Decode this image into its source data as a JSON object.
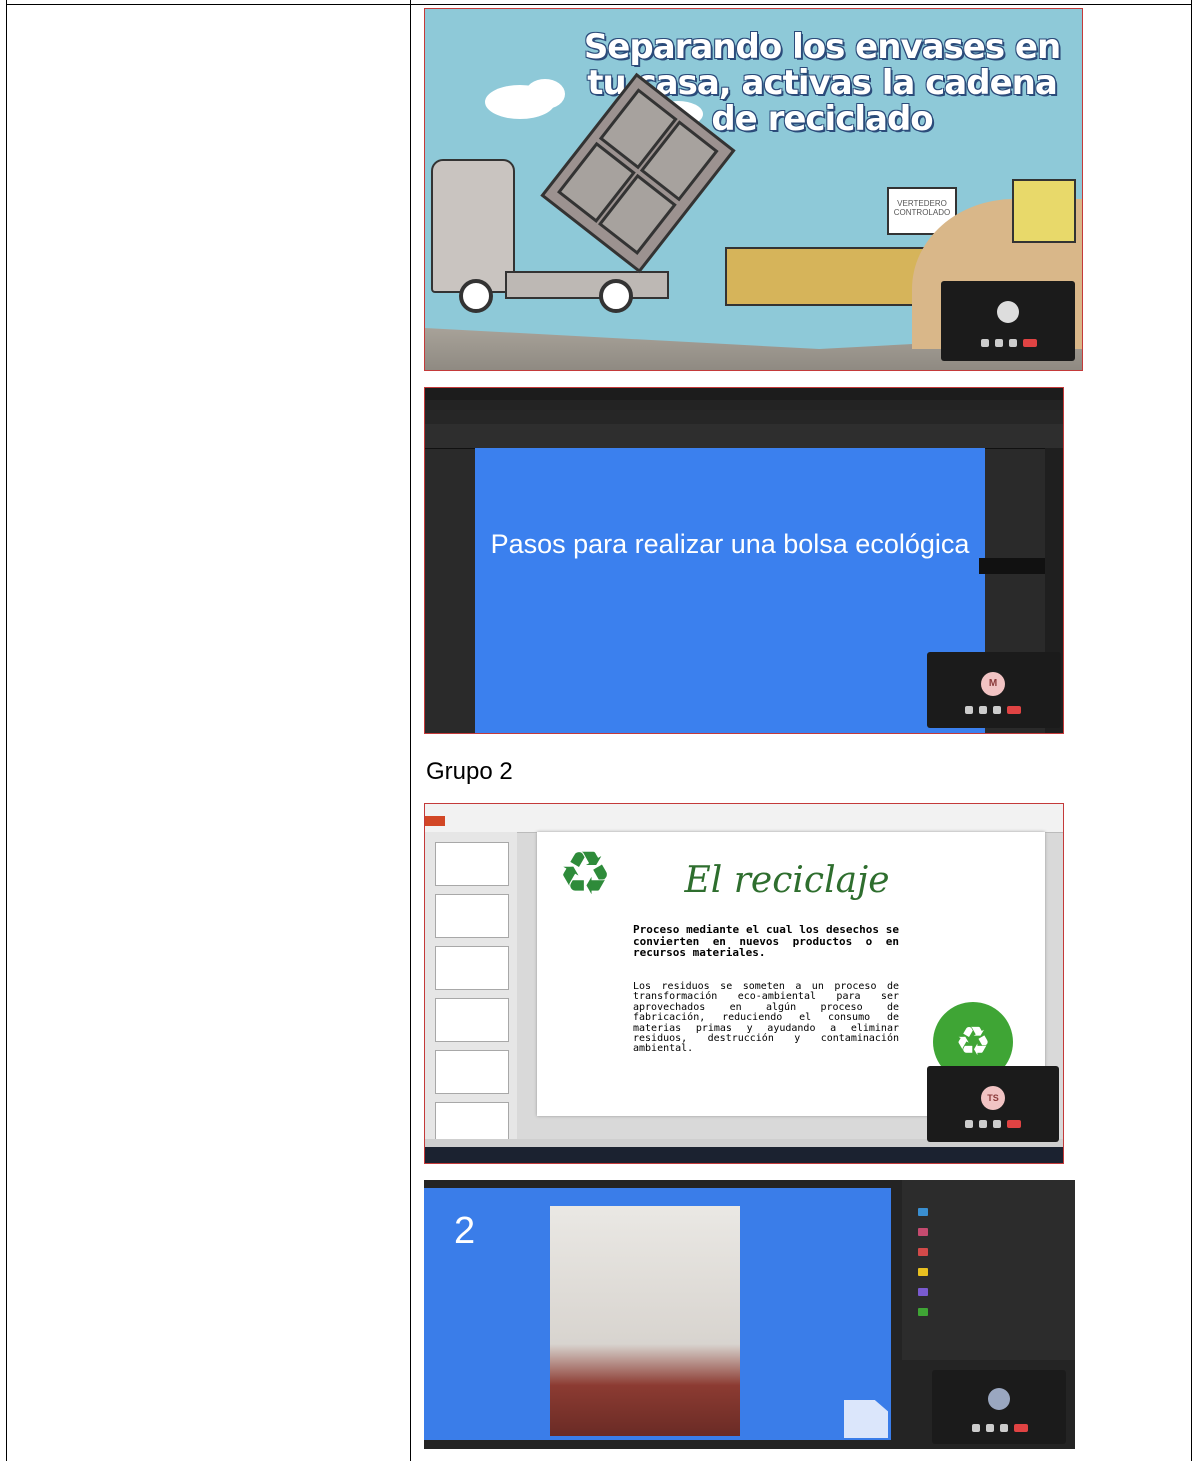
{
  "group_caption": "Grupo 2",
  "shot1": {
    "headline": "Separando los envases en tu casa, activas la cadena de reciclado",
    "sign_text": "VERTEDERO CONTROLADO"
  },
  "shot2": {
    "slide_title": "Pasos para realizar una bolsa ecológica",
    "avatar_initial": "M"
  },
  "shot3": {
    "slide_title": "El reciclaje",
    "lead_text": "Proceso mediante el cual los desechos se convierten en nuevos productos o en recursos materiales.",
    "body_text": "Los residuos se someten a un proceso de transformación eco-ambiental para ser aprovechados en algún proceso de fabricación, reduciendo el consumo de materias primas y ayudando a eliminar residuos, destrucción y contaminación ambiental.",
    "avatar_initial": "TS"
  },
  "shot4": {
    "slide_number": "2"
  },
  "colors": {
    "slide_blue": "#3b80ee",
    "recycle_green": "#2e8b3a",
    "meet_end_red": "#e04343"
  }
}
